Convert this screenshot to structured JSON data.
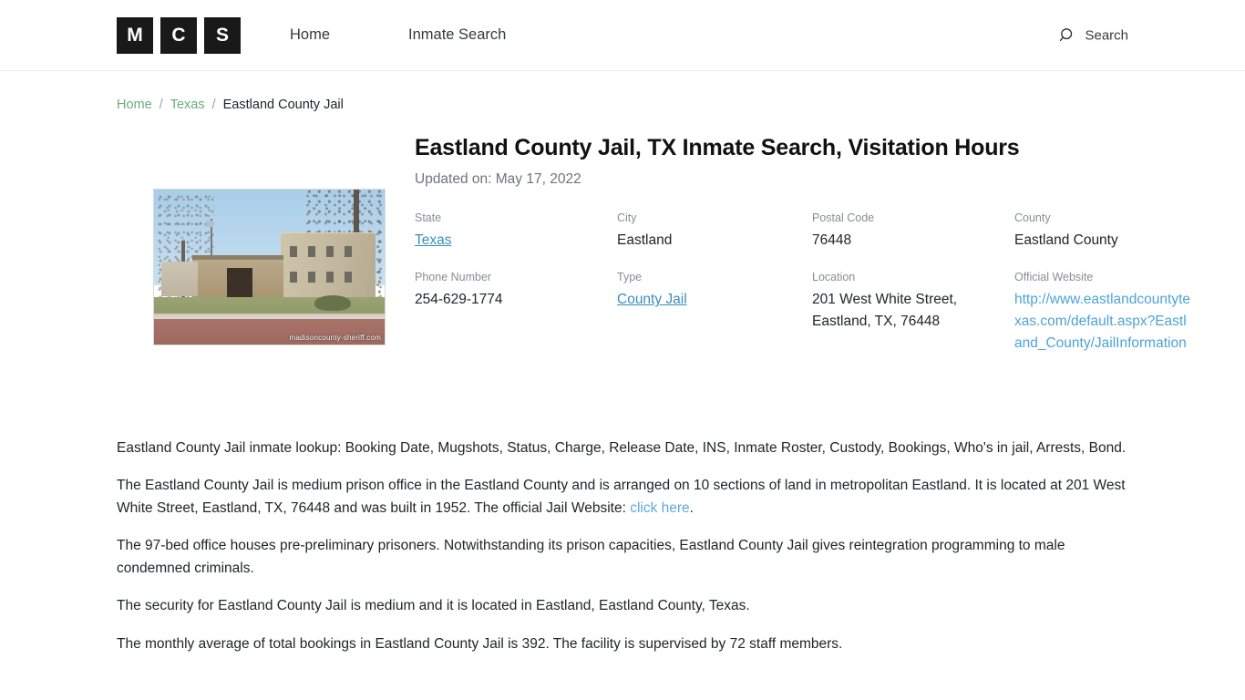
{
  "header": {
    "logo_letters": [
      "M",
      "C",
      "S"
    ],
    "nav": [
      {
        "label": "Home",
        "name": "nav-home"
      },
      {
        "label": "Inmate Search",
        "name": "nav-inmate-search"
      }
    ],
    "search_label": "Search",
    "search_icon": "search-icon"
  },
  "breadcrumb": {
    "home": "Home",
    "sep1": "/",
    "state": "Texas",
    "sep2": "/",
    "current": "Eastland County Jail"
  },
  "hero": {
    "title": "Eastland County Jail, TX Inmate Search, Visitation Hours",
    "updated": "Updated on: May 17, 2022",
    "photo_watermark": "madisoncounty-sheriff.com",
    "photo_alt": "Eastland County Jail building"
  },
  "info": [
    {
      "label": "State",
      "value": "Texas",
      "link": true
    },
    {
      "label": "City",
      "value": "Eastland",
      "link": false
    },
    {
      "label": "Postal Code",
      "value": "76448",
      "link": false
    },
    {
      "label": "County",
      "value": "Eastland County",
      "link": false
    },
    {
      "label": "Phone Number",
      "value": "254-629-1774",
      "link": false
    },
    {
      "label": "Type",
      "value": "County Jail",
      "link": true
    },
    {
      "label": "Location",
      "value": "201 West White Street, Eastland, TX, 76448",
      "link": false
    },
    {
      "label": "Official Website",
      "value": "http://www.eastlandcountytexas.com/default.aspx?Eastland_County/JailInformation",
      "link": true,
      "url": true
    }
  ],
  "article": {
    "p1": "Eastland County Jail inmate lookup: Booking Date, Mugshots, Status, Charge, Release Date, INS, Inmate Roster, Custody, Bookings, Who's in jail, Arrests, Bond.",
    "p2_before": "The Eastland County Jail is medium prison office in the Eastland County and is arranged on 10 sections of land in metropolitan Eastland. It is located at 201 West White Street, Eastland, TX, 76448 and was built in 1952. The official Jail Website: ",
    "p2_link": "click here",
    "p2_after": ".",
    "p3": "The 97-bed office houses pre-preliminary prisoners. Notwithstanding its prison capacities, Eastland County Jail gives reintegration programming to male condemned criminals.",
    "p4": "The security for Eastland County Jail is medium and it is located in Eastland, Eastland County, Texas.",
    "p5": "The monthly average of total bookings in Eastland County Jail is 392. The facility is supervised by 72 staff members."
  },
  "colors": {
    "link_blue": "#3c8dbc",
    "url_blue": "#4ea3d8",
    "breadcrumb_green": "#6aab7c",
    "logo_black": "#191919",
    "label_gray": "#868e96"
  }
}
